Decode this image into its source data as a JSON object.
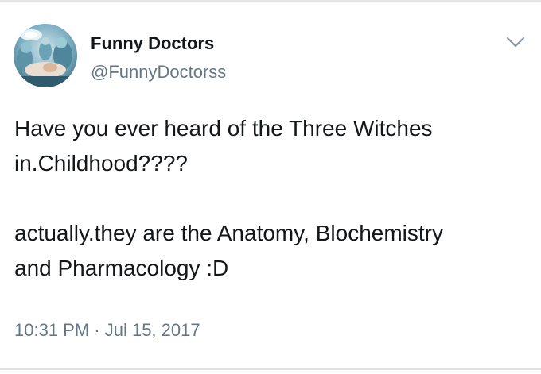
{
  "tweet": {
    "author": {
      "display_name": "Funny Doctors",
      "handle": "@FunnyDoctorss",
      "avatar_icon": "surgery-team-photo"
    },
    "menu_icon": "chevron-down-icon",
    "text": {
      "paragraph_1": "Have you ever heard of the Three Witches\nin.Childhood????",
      "paragraph_2": "actually.they are the Anatomy, Blochemistry\nand Pharmacology :D"
    },
    "timestamp": "10:31 PM · Jul 15, 2017"
  },
  "colors": {
    "name": "#14171a",
    "secondary": "#657786",
    "divider": "#e1e1e1"
  }
}
